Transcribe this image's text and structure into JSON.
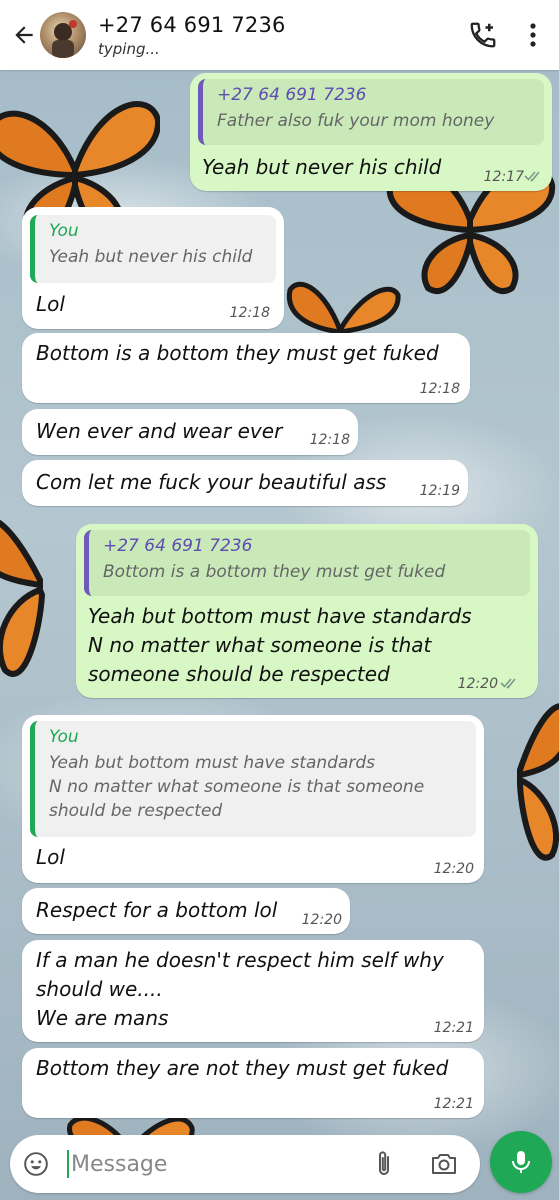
{
  "colors": {
    "accent_green": "#1fa855",
    "outgoing_bubble": "#d7f7c5",
    "incoming_bubble": "#ffffff",
    "quote_author_purple": "#5e4cb0"
  },
  "header": {
    "contact_name": "+27 64 691 7236",
    "status": "typing...",
    "icons": [
      "back-arrow-icon",
      "contact-avatar",
      "add-call-icon",
      "more-vertical-icon"
    ]
  },
  "messages": [
    {
      "direction": "outgoing",
      "quote": {
        "author": "+27 64 691 7236",
        "text": "Father also fuk your mom honey"
      },
      "text": "Yeah but never his child",
      "time": "12:17",
      "status": "read"
    },
    {
      "direction": "incoming",
      "quote": {
        "author": "You",
        "text": "Yeah but never his child"
      },
      "text": "Lol",
      "time": "12:18"
    },
    {
      "direction": "incoming",
      "text": "Bottom is a bottom they must get fuked",
      "time": "12:18"
    },
    {
      "direction": "incoming",
      "text": "Wen ever and wear ever",
      "time": "12:18"
    },
    {
      "direction": "incoming",
      "text": "Com let me fuck your beautiful ass",
      "time": "12:19"
    },
    {
      "direction": "outgoing",
      "quote": {
        "author": "+27 64 691 7236",
        "text": "Bottom is a bottom they must get fuked"
      },
      "text": "Yeah but bottom must have standards\nN no matter what someone is that\nsomeone should be respected",
      "time": "12:20",
      "status": "read"
    },
    {
      "direction": "incoming",
      "quote": {
        "author": "You",
        "text": "Yeah but bottom must have standards\nN no matter what someone is that someone\nshould be respected"
      },
      "text": "Lol",
      "time": "12:20"
    },
    {
      "direction": "incoming",
      "text": "Respect for a bottom lol",
      "time": "12:20"
    },
    {
      "direction": "incoming",
      "text": "If a man he doesn't respect him self why\nshould we....\nWe are mans",
      "time": "12:21"
    },
    {
      "direction": "incoming",
      "text": "Bottom they are not they must get fuked",
      "time": "12:21"
    }
  ],
  "composer": {
    "placeholder": "Message",
    "icons": [
      "emoji-icon",
      "attach-icon",
      "camera-icon",
      "mic-icon"
    ]
  }
}
